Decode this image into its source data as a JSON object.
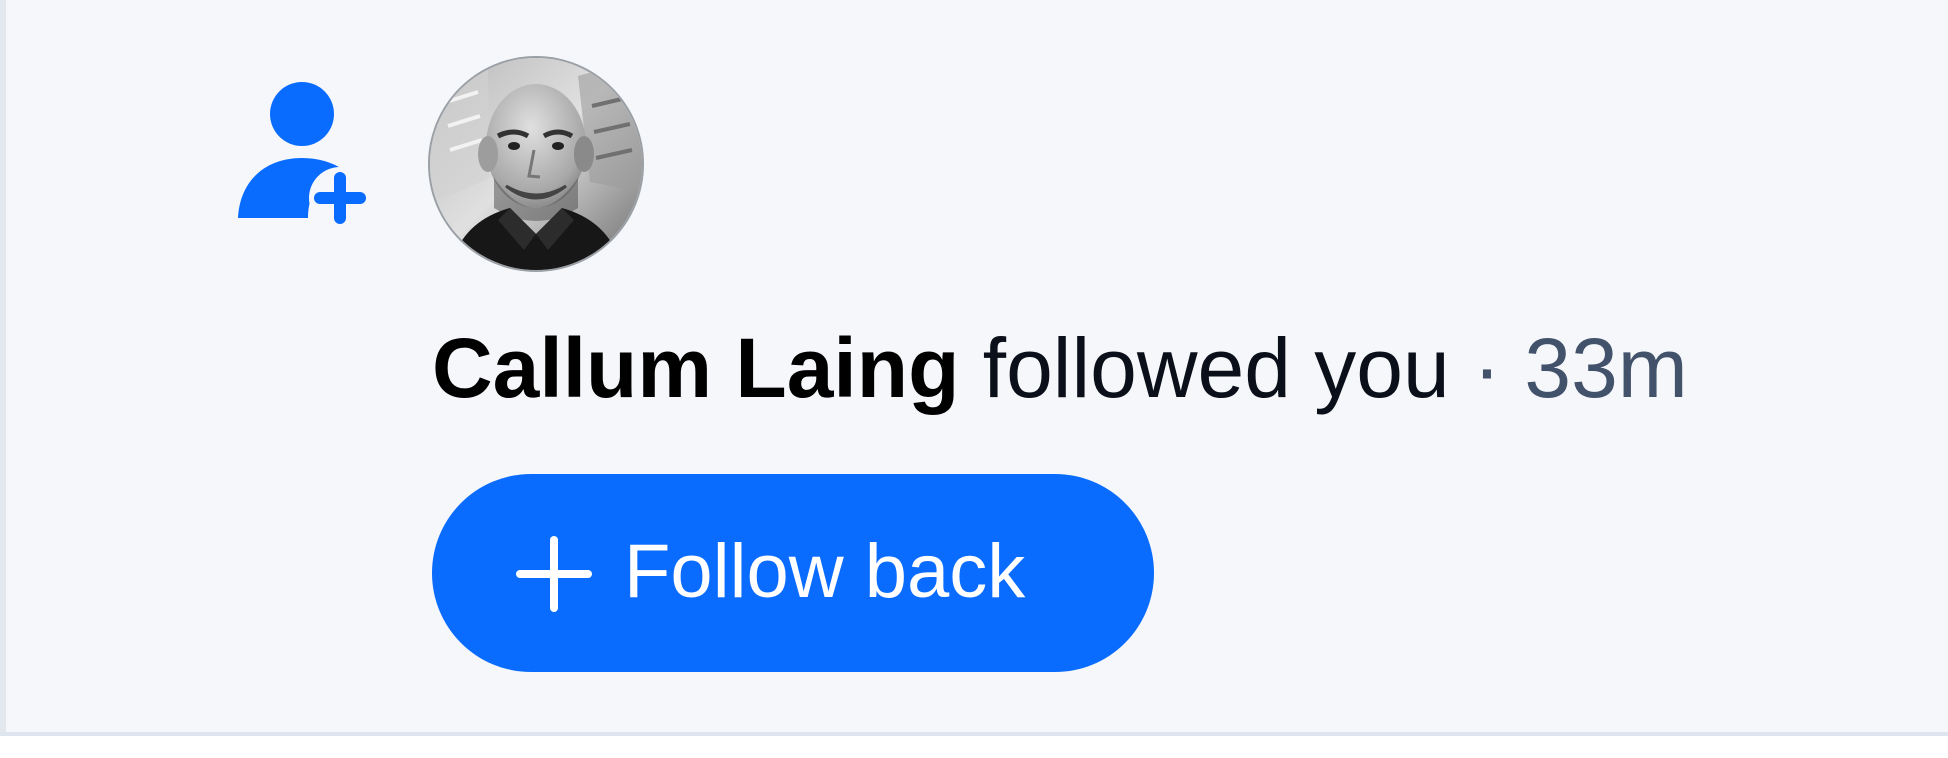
{
  "notification": {
    "type_icon": "user-plus-icon",
    "avatar_icon": "profile-photo",
    "actor_name": "Callum Laing",
    "action_text": "followed you",
    "separator": "·",
    "timestamp": "33m",
    "button": {
      "icon": "plus-icon",
      "label": "Follow back"
    }
  },
  "colors": {
    "accent": "#0a6cff",
    "background": "#f5f7fa",
    "muted_text": "#42526b",
    "primary_text": "#000000"
  }
}
